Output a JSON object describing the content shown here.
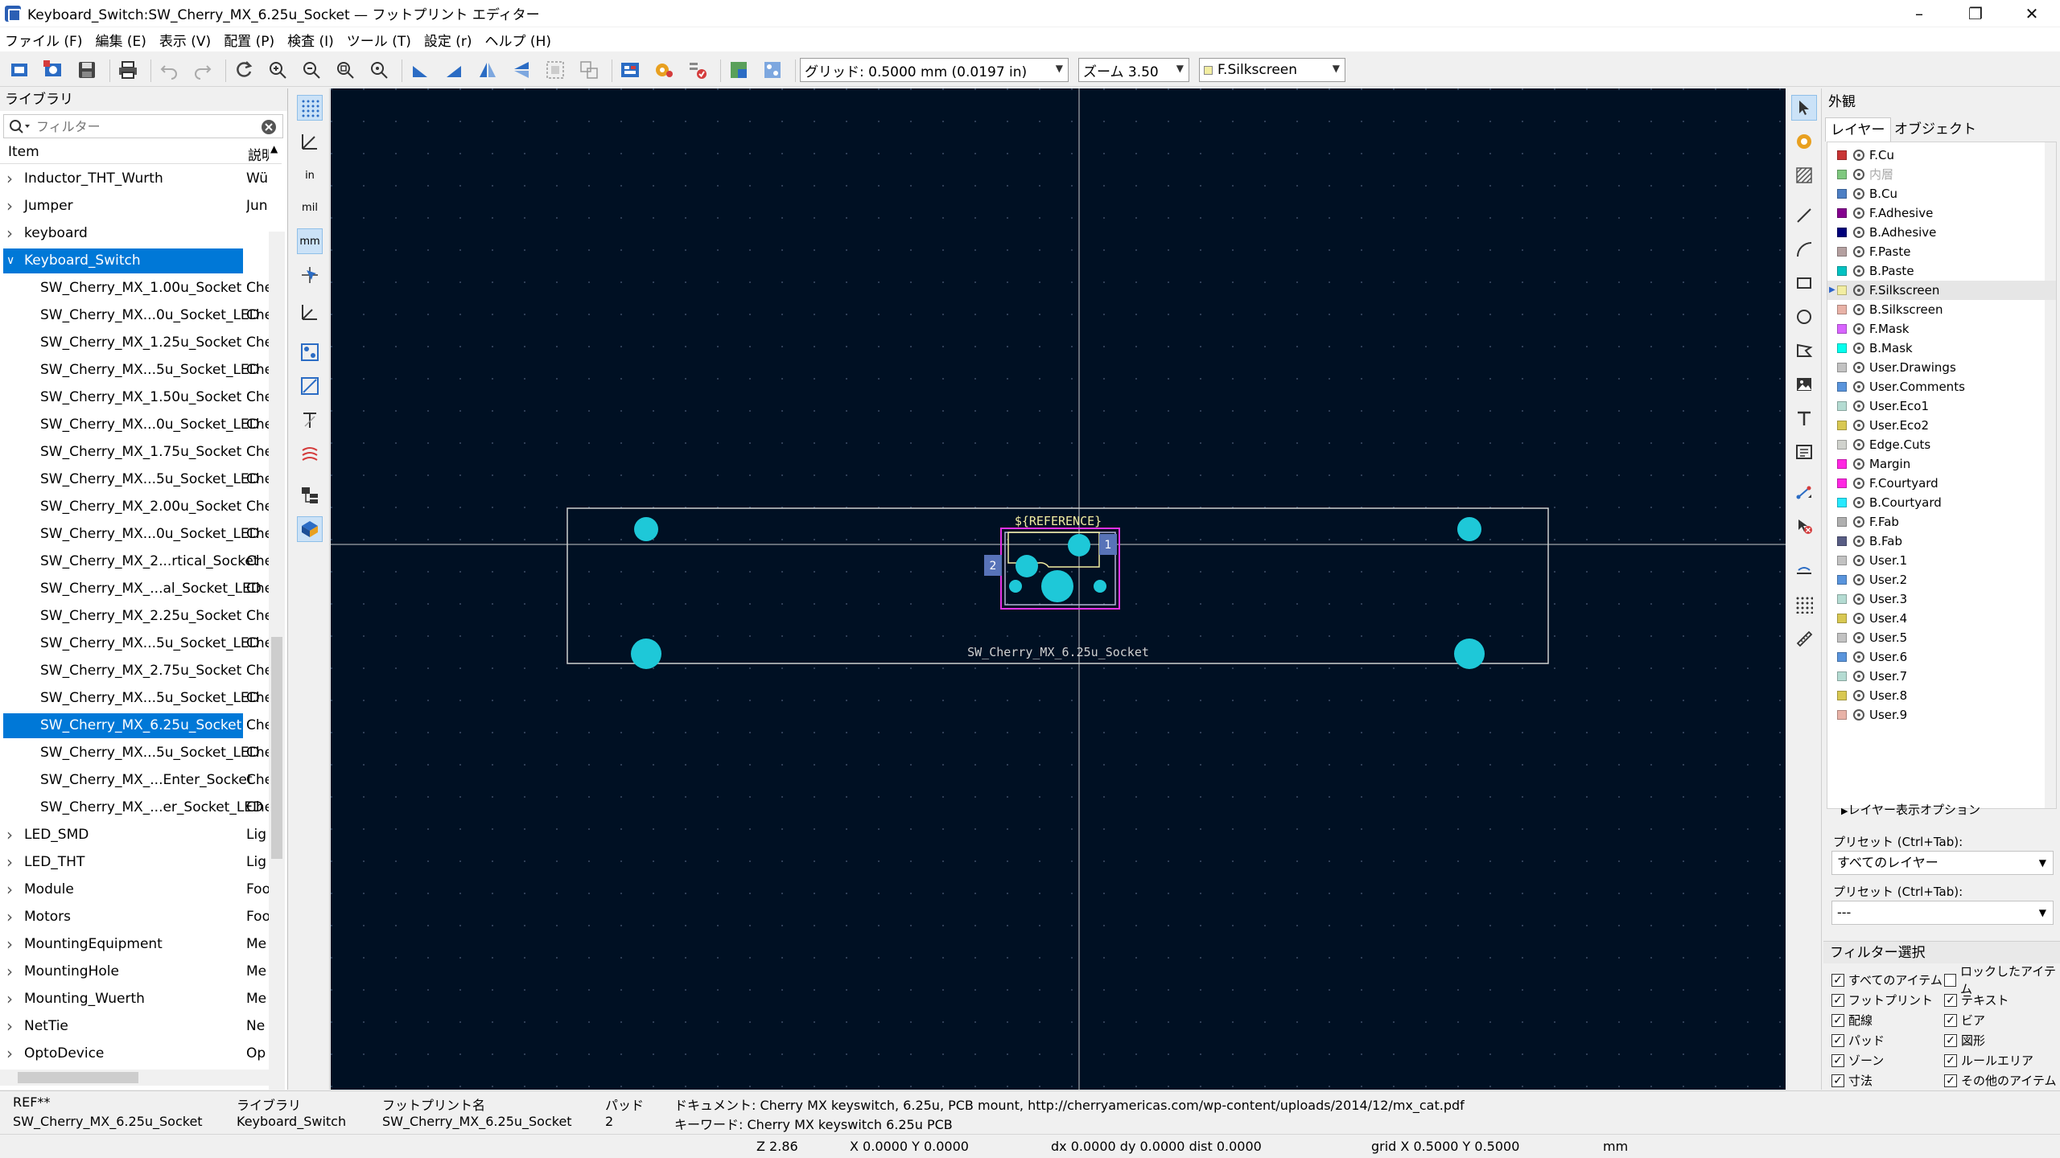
{
  "window": {
    "title": "Keyboard_Switch:SW_Cherry_MX_6.25u_Socket — フットプリント エディター"
  },
  "menu": [
    "ファイル (F)",
    "編集 (E)",
    "表示 (V)",
    "配置 (P)",
    "検査 (I)",
    "ツール (T)",
    "設定 (r)",
    "ヘルプ (H)"
  ],
  "toolbar": {
    "grid": "グリッド: 0.5000 mm (0.0197 in)",
    "zoom": "ズーム 3.50",
    "layer": "F.Silkscreen",
    "layer_color": "#f2eda1"
  },
  "library": {
    "title": "ライブラリ",
    "filter_placeholder": "フィルター",
    "col_item": "Item",
    "col_desc": "説明",
    "rows": [
      {
        "name": "Inductor_THT_Wurth",
        "desc": "Wü",
        "level": 0,
        "selected": false
      },
      {
        "name": "Jumper",
        "desc": "Jun",
        "level": 0,
        "selected": false
      },
      {
        "name": "keyboard",
        "desc": "",
        "level": 0,
        "selected": false
      },
      {
        "name": "Keyboard_Switch",
        "desc": "",
        "level": 0,
        "selected": true,
        "expanded": true
      },
      {
        "name": "SW_Cherry_MX_1.00u_Socket",
        "desc": "Che",
        "level": 1,
        "selected": false
      },
      {
        "name": "SW_Cherry_MX...0u_Socket_LED",
        "desc": "Che",
        "level": 1,
        "selected": false
      },
      {
        "name": "SW_Cherry_MX_1.25u_Socket",
        "desc": "Che",
        "level": 1,
        "selected": false
      },
      {
        "name": "SW_Cherry_MX...5u_Socket_LED",
        "desc": "Che",
        "level": 1,
        "selected": false
      },
      {
        "name": "SW_Cherry_MX_1.50u_Socket",
        "desc": "Che",
        "level": 1,
        "selected": false
      },
      {
        "name": "SW_Cherry_MX...0u_Socket_LED",
        "desc": "Che",
        "level": 1,
        "selected": false
      },
      {
        "name": "SW_Cherry_MX_1.75u_Socket",
        "desc": "Che",
        "level": 1,
        "selected": false
      },
      {
        "name": "SW_Cherry_MX...5u_Socket_LED",
        "desc": "Che",
        "level": 1,
        "selected": false
      },
      {
        "name": "SW_Cherry_MX_2.00u_Socket",
        "desc": "Che",
        "level": 1,
        "selected": false
      },
      {
        "name": "SW_Cherry_MX...0u_Socket_LED",
        "desc": "Che",
        "level": 1,
        "selected": false
      },
      {
        "name": "SW_Cherry_MX_2...rtical_Socket",
        "desc": "Che",
        "level": 1,
        "selected": false
      },
      {
        "name": "SW_Cherry_MX_...al_Socket_LED",
        "desc": "Che",
        "level": 1,
        "selected": false
      },
      {
        "name": "SW_Cherry_MX_2.25u_Socket",
        "desc": "Che",
        "level": 1,
        "selected": false
      },
      {
        "name": "SW_Cherry_MX...5u_Socket_LED",
        "desc": "Che",
        "level": 1,
        "selected": false
      },
      {
        "name": "SW_Cherry_MX_2.75u_Socket",
        "desc": "Che",
        "level": 1,
        "selected": false
      },
      {
        "name": "SW_Cherry_MX...5u_Socket_LED",
        "desc": "Che",
        "level": 1,
        "selected": false
      },
      {
        "name": "SW_Cherry_MX_6.25u_Socket",
        "desc": "Che",
        "level": 1,
        "selected": true
      },
      {
        "name": "SW_Cherry_MX...5u_Socket_LED",
        "desc": "Che",
        "level": 1,
        "selected": false
      },
      {
        "name": "SW_Cherry_MX_...Enter_Socket",
        "desc": "Che",
        "level": 1,
        "selected": false
      },
      {
        "name": "SW_Cherry_MX_...er_Socket_LED",
        "desc": "Che",
        "level": 1,
        "selected": false
      },
      {
        "name": "LED_SMD",
        "desc": "Lig",
        "level": 0,
        "selected": false
      },
      {
        "name": "LED_THT",
        "desc": "Lig",
        "level": 0,
        "selected": false
      },
      {
        "name": "Module",
        "desc": "Foo",
        "level": 0,
        "selected": false
      },
      {
        "name": "Motors",
        "desc": "Foo",
        "level": 0,
        "selected": false
      },
      {
        "name": "MountingEquipment",
        "desc": "Me",
        "level": 0,
        "selected": false
      },
      {
        "name": "MountingHole",
        "desc": "Me",
        "level": 0,
        "selected": false
      },
      {
        "name": "Mounting_Wuerth",
        "desc": "Me",
        "level": 0,
        "selected": false
      },
      {
        "name": "NetTie",
        "desc": "Ne",
        "level": 0,
        "selected": false
      },
      {
        "name": "OptoDevice",
        "desc": "Op",
        "level": 0,
        "selected": false
      }
    ]
  },
  "canvas": {
    "reference_text": "${REFERENCE}",
    "value_text": "SW_Cherry_MX_6.25u_Socket",
    "pad1": "1",
    "pad2": "2",
    "colors": {
      "background": "#001023",
      "pad": "#1ec8d8",
      "courtyard": "#e632e6",
      "silk": "#f2eda1",
      "fab": "#b4b4d4",
      "grid_dot": "#3c4d66",
      "axis": "#c8c8c8"
    }
  },
  "appearance": {
    "title": "外観",
    "tab_layers": "レイヤー",
    "tab_objects": "オブジェクト",
    "layers": [
      {
        "name": "F.Cu",
        "color": "#c83434",
        "dim": false,
        "current": false
      },
      {
        "name": "内層",
        "color": "#7fc87f",
        "dim": true,
        "current": false
      },
      {
        "name": "B.Cu",
        "color": "#4d7fc4",
        "dim": false,
        "current": false
      },
      {
        "name": "F.Adhesive",
        "color": "#84008e",
        "dim": false,
        "current": false
      },
      {
        "name": "B.Adhesive",
        "color": "#00007a",
        "dim": false,
        "current": false
      },
      {
        "name": "F.Paste",
        "color": "#b4a0a0",
        "dim": false,
        "current": false
      },
      {
        "name": "B.Paste",
        "color": "#00c2c2",
        "dim": false,
        "current": false
      },
      {
        "name": "F.Silkscreen",
        "color": "#f2eda1",
        "dim": false,
        "current": true
      },
      {
        "name": "B.Silkscreen",
        "color": "#e8b2a7",
        "dim": false,
        "current": false
      },
      {
        "name": "F.Mask",
        "color": "#d864ff",
        "dim": false,
        "current": false
      },
      {
        "name": "B.Mask",
        "color": "#02ffee",
        "dim": false,
        "current": false
      },
      {
        "name": "User.Drawings",
        "color": "#c2c2c2",
        "dim": false,
        "current": false
      },
      {
        "name": "User.Comments",
        "color": "#5994dc",
        "dim": false,
        "current": false
      },
      {
        "name": "User.Eco1",
        "color": "#b4dbd2",
        "dim": false,
        "current": false
      },
      {
        "name": "User.Eco2",
        "color": "#d8c852",
        "dim": false,
        "current": false
      },
      {
        "name": "Edge.Cuts",
        "color": "#d0d2cd",
        "dim": false,
        "current": false
      },
      {
        "name": "Margin",
        "color": "#ff26e2",
        "dim": false,
        "current": false
      },
      {
        "name": "F.Courtyard",
        "color": "#ff26e2",
        "dim": false,
        "current": false
      },
      {
        "name": "B.Courtyard",
        "color": "#26e9ff",
        "dim": false,
        "current": false
      },
      {
        "name": "F.Fab",
        "color": "#afafaf",
        "dim": false,
        "current": false
      },
      {
        "name": "B.Fab",
        "color": "#585d84",
        "dim": false,
        "current": false
      },
      {
        "name": "User.1",
        "color": "#c2c2c2",
        "dim": false,
        "current": false
      },
      {
        "name": "User.2",
        "color": "#5994dc",
        "dim": false,
        "current": false
      },
      {
        "name": "User.3",
        "color": "#b4dbd2",
        "dim": false,
        "current": false
      },
      {
        "name": "User.4",
        "color": "#d8c852",
        "dim": false,
        "current": false
      },
      {
        "name": "User.5",
        "color": "#c2c2c2",
        "dim": false,
        "current": false
      },
      {
        "name": "User.6",
        "color": "#5994dc",
        "dim": false,
        "current": false
      },
      {
        "name": "User.7",
        "color": "#b4dbd2",
        "dim": false,
        "current": false
      },
      {
        "name": "User.8",
        "color": "#d8c852",
        "dim": false,
        "current": false
      },
      {
        "name": "User.9",
        "color": "#e8b2a7",
        "dim": false,
        "current": false
      }
    ],
    "layer_options": "レイヤー表示オプション",
    "preset_label": "プリセット (Ctrl+Tab):",
    "preset_value": "すべてのレイヤー",
    "viewport_label": "プリセット (Ctrl+Tab):",
    "viewport_value": "---",
    "filter_title": "フィルター選択",
    "filters": [
      {
        "label": "すべてのアイテム",
        "checked": true
      },
      {
        "label": "ロックしたアイテム",
        "checked": false
      },
      {
        "label": "フットプリント",
        "checked": true
      },
      {
        "label": "テキスト",
        "checked": true
      },
      {
        "label": "配線",
        "checked": true
      },
      {
        "label": "ビア",
        "checked": true
      },
      {
        "label": "パッド",
        "checked": true
      },
      {
        "label": "図形",
        "checked": true
      },
      {
        "label": "ゾーン",
        "checked": true
      },
      {
        "label": "ルールエリア",
        "checked": true
      },
      {
        "label": "寸法",
        "checked": true
      },
      {
        "label": "その他のアイテム",
        "checked": true
      }
    ]
  },
  "messages": {
    "ref_label": "REF**",
    "ref_value": "SW_Cherry_MX_6.25u_Socket",
    "lib_label": "ライブラリ",
    "lib_value": "Keyboard_Switch",
    "fp_label": "フットプリント名",
    "fp_value": "SW_Cherry_MX_6.25u_Socket",
    "pad_label": "パッド",
    "pad_value": "2",
    "doc": "ドキュメント: Cherry MX keyswitch, 6.25u, PCB mount, http://cherryamericas.com/wp-content/uploads/2014/12/mx_cat.pdf",
    "keywords": "キーワード: Cherry MX keyswitch 6.25u PCB"
  },
  "status": {
    "zoom": "Z 2.86",
    "xy": "X 0.0000  Y 0.0000",
    "delta": "dx 0.0000  dy 0.0000  dist 0.0000",
    "grid": "grid X 0.5000  Y 0.5000",
    "units": "mm"
  }
}
